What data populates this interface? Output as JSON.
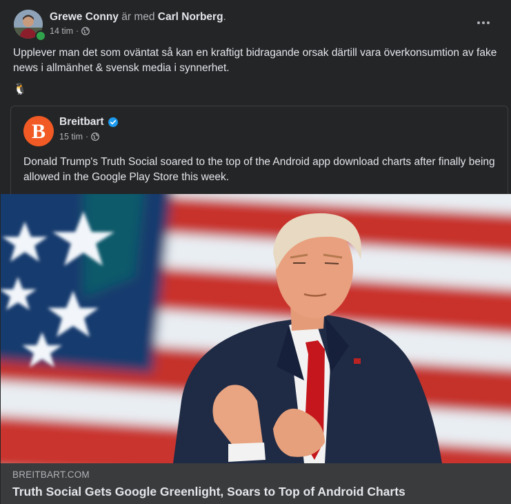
{
  "post": {
    "author": "Grewe Conny",
    "with_text": "är med",
    "tagged": "Carl Norberg",
    "period": ".",
    "time": "14 tim",
    "dot": "·",
    "privacy_icon": "globe-icon",
    "more_icon": "more-options-icon",
    "text": "Upplever man det som oväntat så kan en kraftigt bidragande orsak därtill vara överkonsumtion av fake news i allmänhet & svensk media i synnerhet.",
    "emoji": "🐧"
  },
  "shared": {
    "page_name": "Breitbart",
    "verified_icon": "verified-badge-icon",
    "time": "15 tim",
    "dot": "·",
    "privacy_icon": "globe-icon",
    "text": "Donald Trump's Truth Social soared to the top of the Android app download charts after finally being allowed in the Google Play Store this week.",
    "logo_letter": "B"
  },
  "link": {
    "domain": "BREITBART.COM",
    "title": "Truth Social Gets Google Greenlight, Soars to Top of Android Charts"
  },
  "colors": {
    "background": "#242526",
    "link_footer": "#3a3b3c",
    "text_primary": "#e4e6eb",
    "text_secondary": "#b0b3b8",
    "online_green": "#31a24c",
    "verified_blue": "#1d9bf0",
    "breitbart_orange": "#f15a24"
  }
}
